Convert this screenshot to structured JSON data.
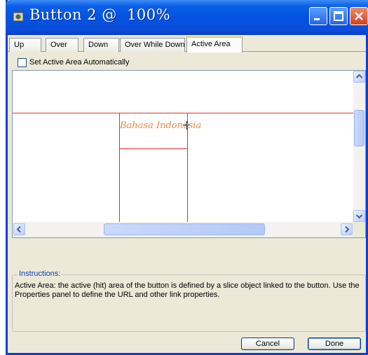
{
  "window": {
    "title": "Button 2 @  100%"
  },
  "tabs": [
    {
      "label": "Up"
    },
    {
      "label": "Over"
    },
    {
      "label": "Down"
    },
    {
      "label": "Over While Down"
    },
    {
      "label": "Active Area",
      "active": true
    }
  ],
  "options": {
    "auto_active_area_label": "Set Active Area Automatically",
    "auto_active_area_checked": false
  },
  "canvas": {
    "button_text": "Bahasa Indonesia",
    "guide_color": "#e3322c",
    "text_color": "#f08a3a"
  },
  "instructions": {
    "legend": "Instructions:",
    "text": "Active Area: the active (hit) area of the button is defined by a slice object linked to the button. Use the Properties panel to define the URL and other link properties."
  },
  "buttons": {
    "cancel": "Cancel",
    "done": "Done"
  },
  "colors": {
    "titlebar": "#0353e3",
    "accent_tab": "#ffc83c",
    "legend": "#1140b8"
  }
}
